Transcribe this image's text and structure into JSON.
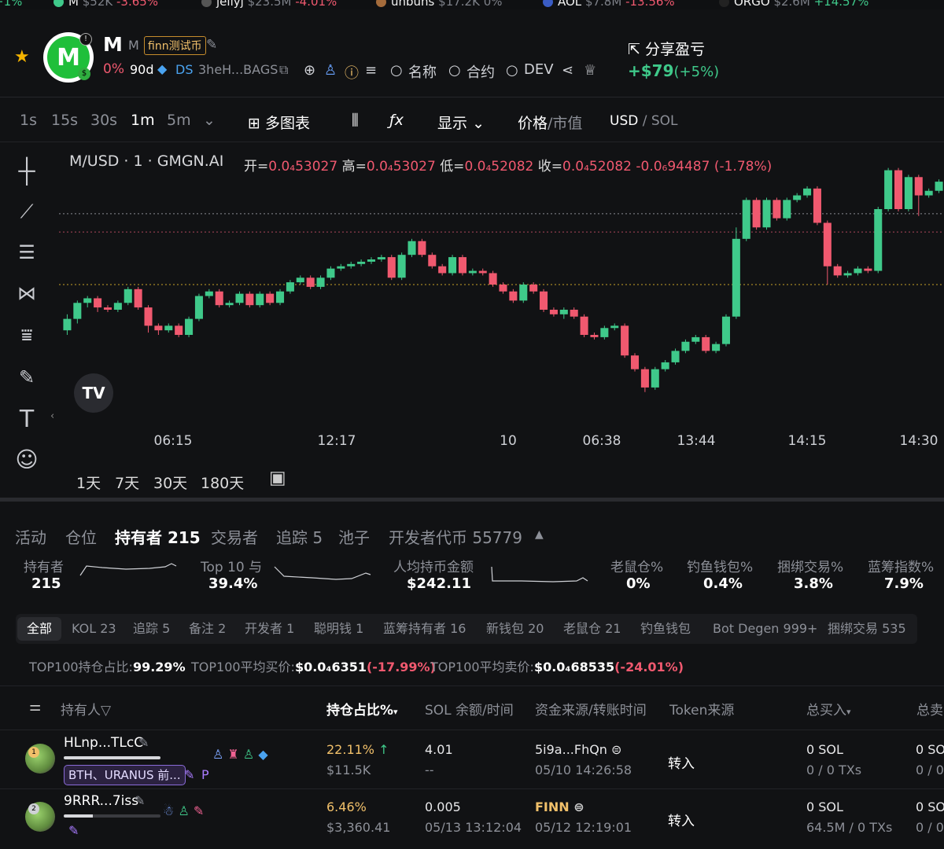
{
  "ticker": [
    {
      "pct": "+1%",
      "pct_color": "#3fc98a"
    },
    {
      "name": "M",
      "cap": "$52K",
      "pct": "-3.65%",
      "pct_color": "#f0596f",
      "dot": "#3fc98a"
    },
    {
      "name": "jellyj",
      "cap": "$23.5M",
      "pct": "-4.01%",
      "pct_color": "#f0596f",
      "dot": "#444"
    },
    {
      "name": "unbuns",
      "cap": "$17.2K",
      "pct": "0%",
      "pct_color": "#7d8088",
      "dot": "#a46b3b"
    },
    {
      "name": "AOL",
      "cap": "$7.8M",
      "pct": "-13.56%",
      "pct_color": "#f0596f",
      "dot": "#3a5cc4"
    },
    {
      "name": "ORGO",
      "cap": "$2.6M",
      "pct": "+14.57%",
      "pct_color": "#3fc98a",
      "dot": "#111"
    }
  ],
  "token": {
    "symbol": "M",
    "name": "M",
    "tag": "finn测试币",
    "change": "0%",
    "age": "90d",
    "ds": "DS",
    "address": "3heH...BAGS",
    "search_name": "名称",
    "search_contract": "合约",
    "search_dev": "DEV",
    "logo_letter": "M"
  },
  "pnl": {
    "share_label": "分享盈亏",
    "value": "+$79",
    "pct": "(+5%)"
  },
  "toolbar": {
    "intervals": [
      "1s",
      "15s",
      "30s",
      "1m",
      "5m"
    ],
    "active_interval": "1m",
    "multi_chart": "多图表",
    "display": "显示",
    "price": "价格",
    "mcap": "市值",
    "usd": "USD",
    "sol": "SOL"
  },
  "chart_caption": {
    "pair": "M/USD · 1 · GMGN.AI",
    "open_label": "开=",
    "open": "0.0₄53027",
    "high_label": "高=",
    "high": "0.0₄53027",
    "low_label": "低=",
    "low": "0.0₄52082",
    "close_label": "收=",
    "close": "0.0₄52082",
    "change": "-0.0₆94487 (-1.78%)"
  },
  "chart_data": {
    "type": "candlestick",
    "x_tick_labels": [
      "06:15",
      "12:17",
      "10",
      "06:38",
      "13:44",
      "14:15",
      "14:30"
    ],
    "candles": [
      [
        0.35,
        0.4,
        0.33,
        0.42
      ],
      [
        0.4,
        0.47,
        0.38,
        0.48
      ],
      [
        0.47,
        0.49,
        0.45,
        0.5
      ],
      [
        0.49,
        0.45,
        0.43,
        0.5
      ],
      [
        0.45,
        0.44,
        0.43,
        0.46
      ],
      [
        0.44,
        0.47,
        0.43,
        0.48
      ],
      [
        0.47,
        0.53,
        0.46,
        0.54
      ],
      [
        0.53,
        0.45,
        0.44,
        0.54
      ],
      [
        0.45,
        0.37,
        0.34,
        0.46
      ],
      [
        0.37,
        0.35,
        0.33,
        0.38
      ],
      [
        0.35,
        0.37,
        0.34,
        0.38
      ],
      [
        0.37,
        0.33,
        0.32,
        0.38
      ],
      [
        0.33,
        0.4,
        0.32,
        0.41
      ],
      [
        0.4,
        0.5,
        0.39,
        0.51
      ],
      [
        0.5,
        0.52,
        0.49,
        0.53
      ],
      [
        0.52,
        0.46,
        0.45,
        0.53
      ],
      [
        0.46,
        0.47,
        0.45,
        0.48
      ],
      [
        0.47,
        0.51,
        0.46,
        0.52
      ],
      [
        0.51,
        0.46,
        0.45,
        0.52
      ],
      [
        0.46,
        0.51,
        0.45,
        0.52
      ],
      [
        0.51,
        0.47,
        0.46,
        0.52
      ],
      [
        0.47,
        0.52,
        0.46,
        0.53
      ],
      [
        0.52,
        0.56,
        0.51,
        0.57
      ],
      [
        0.56,
        0.58,
        0.55,
        0.59
      ],
      [
        0.58,
        0.54,
        0.53,
        0.59
      ],
      [
        0.54,
        0.58,
        0.53,
        0.59
      ],
      [
        0.58,
        0.62,
        0.57,
        0.63
      ],
      [
        0.62,
        0.63,
        0.61,
        0.64
      ],
      [
        0.63,
        0.64,
        0.62,
        0.65
      ],
      [
        0.64,
        0.65,
        0.63,
        0.66
      ],
      [
        0.65,
        0.66,
        0.64,
        0.67
      ],
      [
        0.66,
        0.67,
        0.65,
        0.68
      ],
      [
        0.67,
        0.58,
        0.57,
        0.68
      ],
      [
        0.58,
        0.68,
        0.57,
        0.69
      ],
      [
        0.68,
        0.74,
        0.67,
        0.75
      ],
      [
        0.74,
        0.68,
        0.67,
        0.75
      ],
      [
        0.68,
        0.63,
        0.62,
        0.69
      ],
      [
        0.63,
        0.6,
        0.59,
        0.64
      ],
      [
        0.6,
        0.67,
        0.59,
        0.68
      ],
      [
        0.67,
        0.6,
        0.59,
        0.68
      ],
      [
        0.6,
        0.61,
        0.59,
        0.62
      ],
      [
        0.61,
        0.6,
        0.59,
        0.62
      ],
      [
        0.6,
        0.55,
        0.54,
        0.61
      ],
      [
        0.55,
        0.52,
        0.51,
        0.56
      ],
      [
        0.52,
        0.48,
        0.47,
        0.53
      ],
      [
        0.48,
        0.55,
        0.47,
        0.56
      ],
      [
        0.55,
        0.52,
        0.51,
        0.56
      ],
      [
        0.52,
        0.44,
        0.43,
        0.53
      ],
      [
        0.44,
        0.42,
        0.41,
        0.45
      ],
      [
        0.42,
        0.44,
        0.4,
        0.45
      ],
      [
        0.44,
        0.41,
        0.4,
        0.45
      ],
      [
        0.41,
        0.33,
        0.32,
        0.42
      ],
      [
        0.33,
        0.32,
        0.31,
        0.34
      ],
      [
        0.32,
        0.36,
        0.31,
        0.37
      ],
      [
        0.36,
        0.37,
        0.35,
        0.38
      ],
      [
        0.37,
        0.24,
        0.23,
        0.38
      ],
      [
        0.24,
        0.18,
        0.17,
        0.25
      ],
      [
        0.18,
        0.1,
        0.08,
        0.19
      ],
      [
        0.1,
        0.18,
        0.09,
        0.19
      ],
      [
        0.18,
        0.21,
        0.17,
        0.22
      ],
      [
        0.21,
        0.26,
        0.2,
        0.27
      ],
      [
        0.26,
        0.3,
        0.25,
        0.31
      ],
      [
        0.3,
        0.32,
        0.29,
        0.33
      ],
      [
        0.32,
        0.26,
        0.25,
        0.33
      ],
      [
        0.26,
        0.29,
        0.25,
        0.3
      ],
      [
        0.29,
        0.41,
        0.28,
        0.42
      ],
      [
        0.41,
        0.75,
        0.4,
        0.8
      ],
      [
        0.75,
        0.92,
        0.74,
        0.93
      ],
      [
        0.92,
        0.8,
        0.79,
        0.93
      ],
      [
        0.8,
        0.92,
        0.79,
        0.93
      ],
      [
        0.92,
        0.84,
        0.83,
        0.93
      ],
      [
        0.84,
        0.92,
        0.83,
        0.93
      ],
      [
        0.92,
        0.94,
        0.91,
        0.95
      ],
      [
        0.94,
        0.97,
        0.93,
        0.98
      ],
      [
        0.97,
        0.82,
        0.81,
        0.98
      ],
      [
        0.82,
        0.63,
        0.55,
        0.83
      ],
      [
        0.63,
        0.59,
        0.58,
        0.64
      ],
      [
        0.59,
        0.6,
        0.58,
        0.61
      ],
      [
        0.6,
        0.62,
        0.59,
        0.63
      ],
      [
        0.62,
        0.61,
        0.6,
        0.63
      ],
      [
        0.61,
        0.88,
        0.6,
        0.89
      ],
      [
        0.88,
        1.05,
        0.87,
        1.06
      ],
      [
        1.05,
        0.88,
        0.87,
        1.06
      ],
      [
        0.88,
        1.02,
        0.87,
        1.03
      ],
      [
        1.02,
        0.94,
        0.85,
        1.03
      ],
      [
        0.94,
        0.96,
        0.93,
        0.97
      ],
      [
        0.96,
        1.0,
        0.95,
        1.01
      ]
    ],
    "level_lines": [
      0.86,
      0.78,
      0.55
    ],
    "grid": false
  },
  "ranges": [
    "1天",
    "7天",
    "30天",
    "180天"
  ],
  "tabs": [
    {
      "label": "活动"
    },
    {
      "label": "仓位"
    },
    {
      "label": "持有者 215",
      "active": true
    },
    {
      "label": "交易者"
    },
    {
      "label": "追踪 5"
    },
    {
      "label": "池子"
    },
    {
      "label": "开发者代币 55779"
    }
  ],
  "stats": {
    "holders_label": "持有者",
    "holders": "215",
    "top10_label": "Top 10 与",
    "top10": "39.4%",
    "avg_label": "人均持币金额",
    "avg": "$242.11",
    "rat_label": "老鼠仓%",
    "rat": "0%",
    "phish_label": "钓鱼钱包%",
    "phish": "0.4%",
    "bundle_label": "捆绑交易%",
    "bundle": "3.8%",
    "bluechip_label": "蓝筹指数%",
    "bluechip": "7.9%"
  },
  "chips": [
    "全部",
    "KOL 23",
    "追踪 5",
    "备注 2",
    "开发者 1",
    "聪明钱 1",
    "蓝筹持有者 16",
    "新钱包 20",
    "老鼠仓 21",
    "钓鱼钱包",
    "Bot Degen 999+",
    "捆绑交易 535"
  ],
  "summary": {
    "share_label": "TOP100持仓占比:",
    "share": "99.29%",
    "buy_label": "TOP100平均买价:",
    "buy": "$0.0₄6351",
    "buy_pct": "(-17.99%)",
    "sell_label": "TOP100平均卖价:",
    "sell": "$0.0₄68535",
    "sell_pct": "(-24.01%)"
  },
  "table": {
    "headers": {
      "holder": "持有人",
      "share": "持仓占比%",
      "sol": "SOL 余额/时间",
      "source": "资金来源/转账时间",
      "token_src": "Token来源",
      "bought": "总买入",
      "sold": "总卖"
    },
    "rows": [
      {
        "rank": "1",
        "name": "HLnp...TLcC",
        "label": "BTH、URANUS 前...",
        "share": "22.11%",
        "usd": "$11.5K",
        "sol": "4.01",
        "sol_time": "--",
        "source": "5i9a...FhQn",
        "source_time": "05/10 14:26:58",
        "token_src": "转入",
        "bought": "0 SOL",
        "bought_tx": "0 / 0 TXs",
        "sold": "0 SO",
        "sold_tx": "0 / 0"
      },
      {
        "rank": "2",
        "name": "9RRR...7iss",
        "share": "6.46%",
        "usd": "$3,360.41",
        "sol": "0.005",
        "sol_time": "05/13 13:12:04",
        "source": "FINN",
        "source_time": "05/12 12:19:01",
        "token_src": "转入",
        "bought": "0 SOL",
        "bought_tx": "64.5M / 0 TXs",
        "sold": "0 SO",
        "sold_tx": "0 / 0"
      }
    ]
  },
  "colors": {
    "up": "#3fc98a",
    "down": "#f0596f",
    "accent_gold": "#f1c06a"
  }
}
